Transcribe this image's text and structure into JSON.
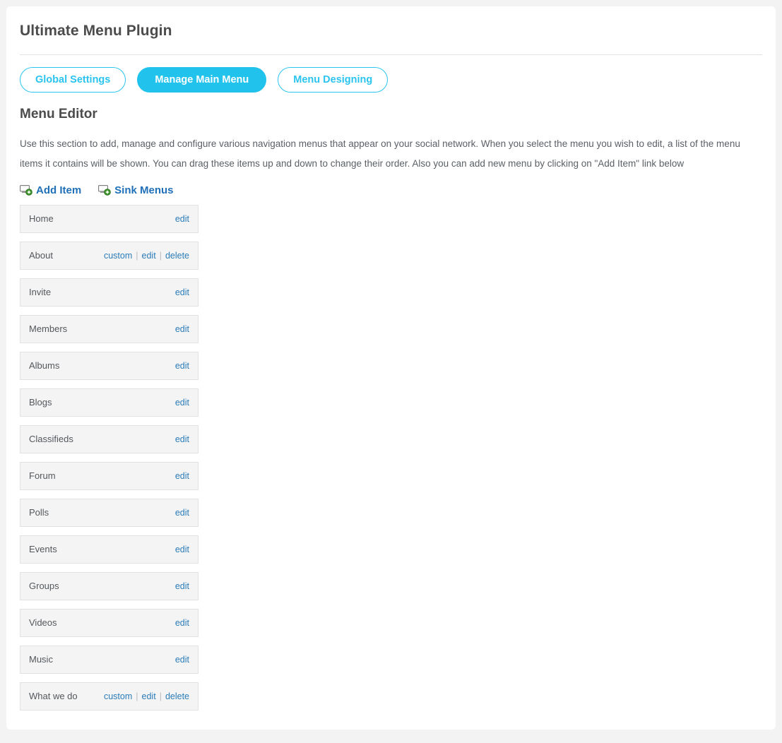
{
  "header": {
    "title": "Ultimate Menu Plugin"
  },
  "tabs": [
    {
      "label": "Global Settings",
      "active": false
    },
    {
      "label": "Manage Main Menu",
      "active": true
    },
    {
      "label": "Menu Designing",
      "active": false
    }
  ],
  "section": {
    "title": "Menu Editor",
    "description": "Use this section to add, manage and configure various navigation menus that appear on your social network. When you select the menu you wish to edit, a list of the menu items it contains will be shown. You can drag these items up and down to change their order. Also you can add new menu by clicking on \"Add Item\" link below"
  },
  "action_links": [
    {
      "label": "Add Item",
      "icon": "monitor-add-icon"
    },
    {
      "label": "Sink Menus",
      "icon": "monitor-add-icon"
    }
  ],
  "row_actions": {
    "custom": "custom",
    "edit": "edit",
    "delete": "delete",
    "separator": "|"
  },
  "menu_items": [
    {
      "label": "Home",
      "actions": [
        "edit"
      ]
    },
    {
      "label": "About",
      "actions": [
        "custom",
        "edit",
        "delete"
      ]
    },
    {
      "label": "Invite",
      "actions": [
        "edit"
      ]
    },
    {
      "label": "Members",
      "actions": [
        "edit"
      ]
    },
    {
      "label": "Albums",
      "actions": [
        "edit"
      ]
    },
    {
      "label": "Blogs",
      "actions": [
        "edit"
      ]
    },
    {
      "label": "Classifieds",
      "actions": [
        "edit"
      ]
    },
    {
      "label": "Forum",
      "actions": [
        "edit"
      ]
    },
    {
      "label": "Polls",
      "actions": [
        "edit"
      ]
    },
    {
      "label": "Events",
      "actions": [
        "edit"
      ]
    },
    {
      "label": "Groups",
      "actions": [
        "edit"
      ]
    },
    {
      "label": "Videos",
      "actions": [
        "edit"
      ]
    },
    {
      "label": "Music",
      "actions": [
        "edit"
      ]
    },
    {
      "label": "What we do",
      "actions": [
        "custom",
        "edit",
        "delete"
      ]
    }
  ],
  "colors": {
    "accent": "#21c2ec",
    "link": "#2b7cb8",
    "action_link": "#1f70b8",
    "row_bg": "#f4f4f4",
    "row_border": "#e2e2e2",
    "text": "#4b4b4b",
    "page_bg": "#f3f3f3"
  }
}
